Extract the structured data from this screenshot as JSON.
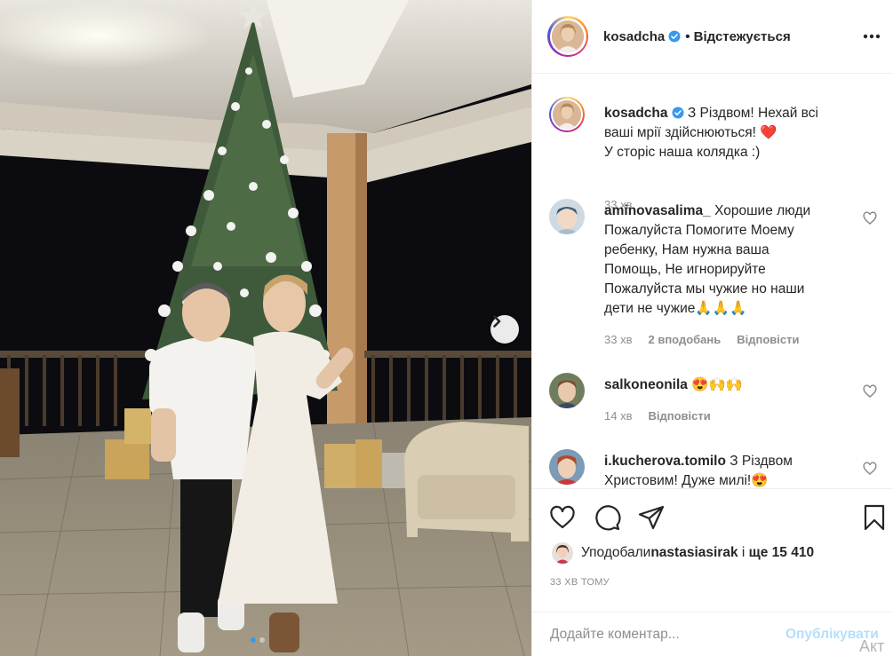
{
  "post": {
    "author": "kosadcha",
    "follow_state": "• Відстежується",
    "more_icon": "more-horizontal-icon",
    "caption": {
      "username": "kosadcha",
      "line1": " З Різдвом! Нехай всі",
      "line2": "ваші мрії здійснюються! ",
      "heart": "❤️",
      "line3": "У сторіс наша колядка :)",
      "time": "33 хв"
    },
    "photo": {
      "next_icon": "chevron-right-icon",
      "carousel_dots": 2,
      "active_dot": 1
    }
  },
  "comments": [
    {
      "username": "aminovasalima_",
      "lines": [
        " Хорошие люди",
        "Пожалуйста Помогите Моему",
        "ребенку, Нам нужна ваша",
        "Помощь, Не игнорируйте",
        "Пожалуйста мы чужие но наши",
        "дети не чужие🙏🙏🙏"
      ],
      "time": "33 хв",
      "likes": "2 вподобань",
      "reply": "Відповісти"
    },
    {
      "username": "salkoneonila",
      "lines": [
        " 😍🙌🙌"
      ],
      "time": "14 хв",
      "likes": "",
      "reply": "Відповісти"
    },
    {
      "username": "i.kucherova.tomilo",
      "lines": [
        " З Різдвом",
        "Христовим! Дуже милі!😍"
      ],
      "time": "",
      "likes": "",
      "reply": ""
    }
  ],
  "actions": {
    "like_icon": "heart-icon",
    "comment_icon": "comment-icon",
    "share_icon": "paper-plane-icon",
    "save_icon": "bookmark-icon"
  },
  "likes": {
    "prefix": "Уподобали ",
    "user": "nastasiasirak",
    "middle": " і ",
    "count": "ще 15 410"
  },
  "timestamp": "33 ХВ ТОМУ",
  "comment_box": {
    "placeholder": "Додайте коментар...",
    "publish_label": "Опублікувати"
  },
  "watermark": "Акт",
  "colors": {
    "link_blue": "#3897f0",
    "publish_disabled": "#b2dffc",
    "muted": "#8e8e8e",
    "text": "#262626",
    "heart_red": "#ed4956"
  }
}
